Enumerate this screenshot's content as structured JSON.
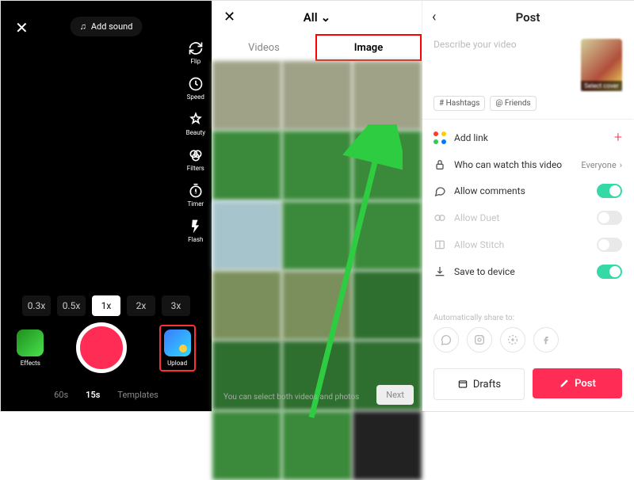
{
  "camera": {
    "add_sound": "Add sound",
    "tools": {
      "flip": "Flip",
      "speed": "Speed",
      "beauty": "Beauty",
      "filters": "Filters",
      "timer": "Timer",
      "flash": "Flash"
    },
    "zoom": {
      "z03": "0.3x",
      "z05": "0.5x",
      "z1": "1x",
      "z2": "2x",
      "z3": "3x",
      "selected": "1x"
    },
    "effects_label": "Effects",
    "upload_label": "Upload",
    "durations": {
      "d60": "60s",
      "d15": "15s",
      "templates": "Templates",
      "selected": "15s"
    }
  },
  "gallery": {
    "all_label": "All",
    "tab_videos": "Videos",
    "tab_image": "Image",
    "hint": "You can select both videos and photos",
    "next": "Next"
  },
  "post": {
    "title": "Post",
    "placeholder": "Describe your video",
    "cover_label": "Select cover",
    "chip_hashtags": "# Hashtags",
    "chip_friends": "@ Friends",
    "rows": {
      "add_link": "Add link",
      "who": "Who can watch this video",
      "who_value": "Everyone",
      "comments": "Allow comments",
      "duet": "Allow Duet",
      "stitch": "Allow Stitch",
      "save": "Save to device"
    },
    "share_label": "Automatically share to:",
    "drafts": "Drafts",
    "post_btn": "Post"
  }
}
